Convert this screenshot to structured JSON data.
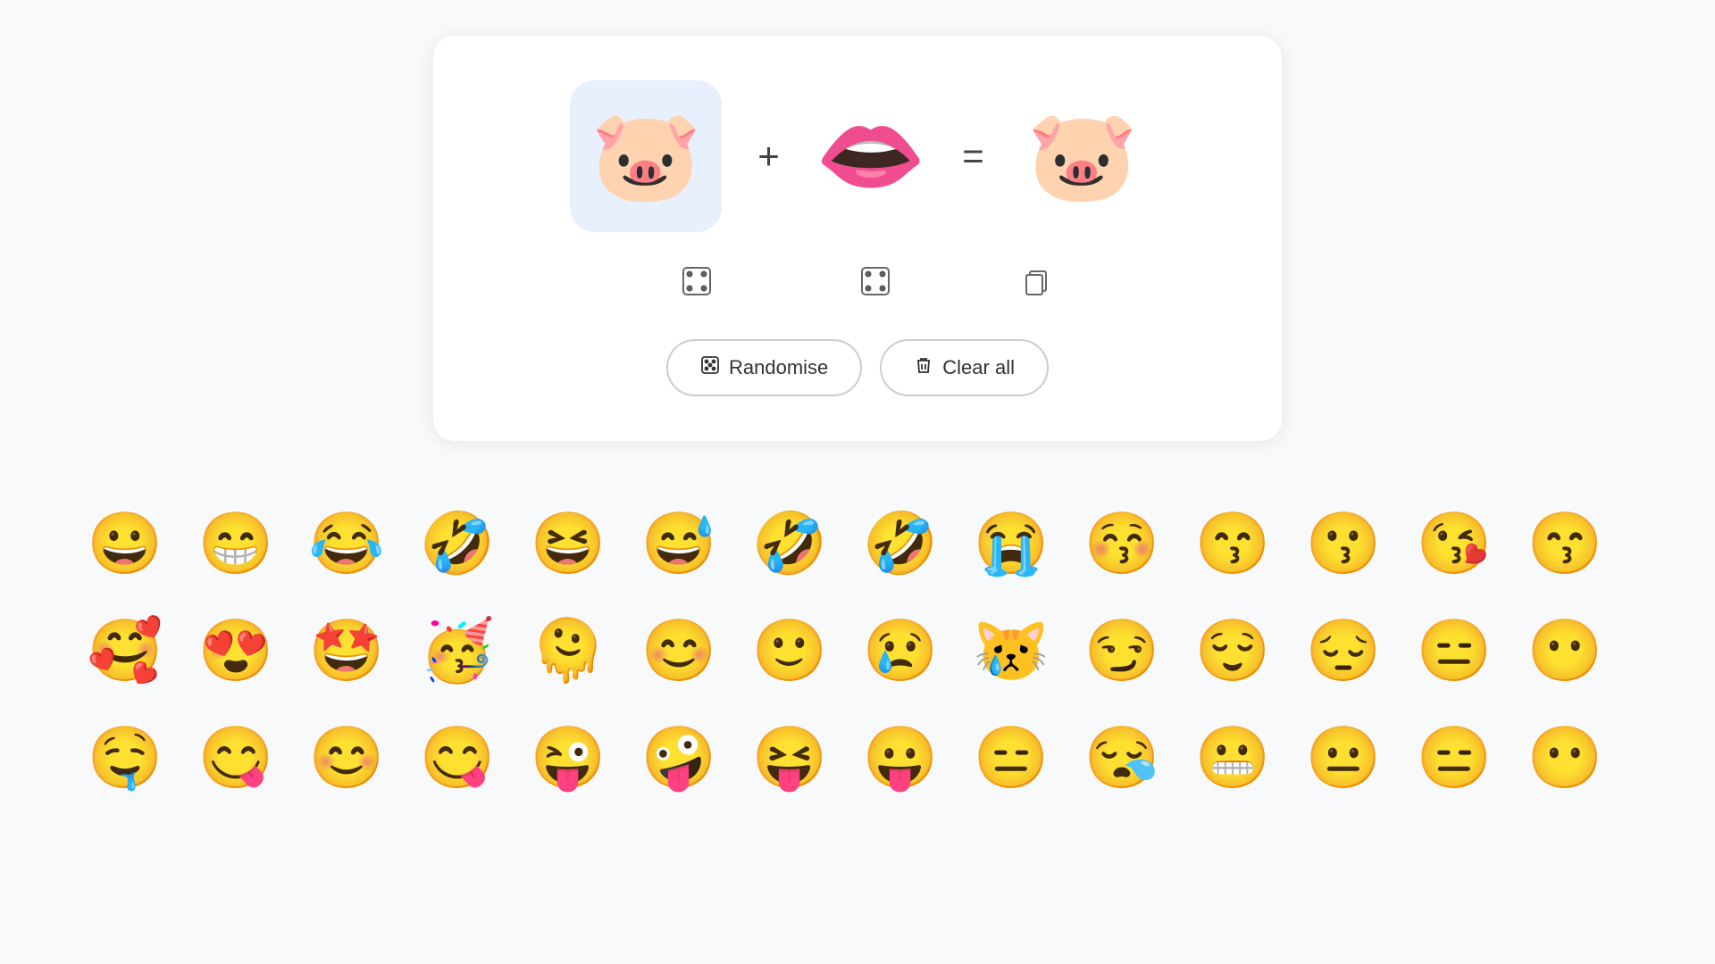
{
  "mixer": {
    "emoji1": "🐷",
    "emoji2": "👄",
    "result": "🐷",
    "plus_operator": "+",
    "equals_operator": "=",
    "randomise_label": "Randomise",
    "clear_all_label": "Clear all"
  },
  "emoji_rows": [
    [
      "😀",
      "😁",
      "😂",
      "🤣",
      "😆",
      "😅",
      "🤣",
      "🤣",
      "😭",
      "😚",
      "😙",
      "😗",
      "😘",
      "😙"
    ],
    [
      "🥰",
      "😍",
      "🤩",
      "🥳",
      "🫠",
      "😊",
      "🙂",
      "😢",
      "😿",
      "😏",
      "😌",
      "😔",
      "😑",
      "😶"
    ],
    [
      "🤤",
      "😋",
      "😊",
      "😋",
      "😜",
      "🤪",
      "😝",
      "😛",
      "😑",
      "😪",
      "😬",
      "😐",
      "😑",
      "😶"
    ]
  ],
  "icons": {
    "dice_label": "randomise-dice-icon",
    "copy_label": "copy-icon",
    "trash_label": "trash-icon"
  }
}
